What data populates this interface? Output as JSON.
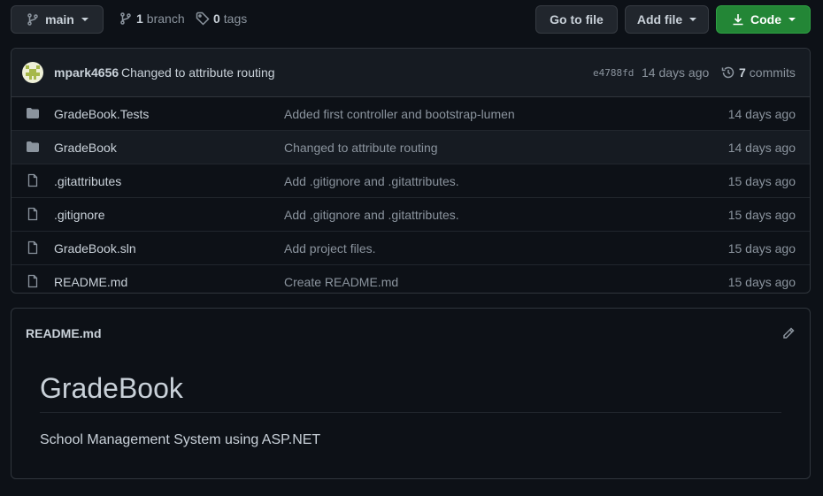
{
  "toolbar": {
    "branch_button": "main",
    "branch_count": "1",
    "branch_label": "branch",
    "tag_count": "0",
    "tag_label": "tags",
    "go_to_file": "Go to file",
    "add_file": "Add file",
    "code": "Code"
  },
  "commit": {
    "author": "mpark4656",
    "message": "Changed to attribute routing",
    "hash": "e4788fd",
    "age": "14 days ago",
    "count": "7",
    "count_label": "commits"
  },
  "files": [
    {
      "type": "folder",
      "name": "GradeBook.Tests",
      "message": "Added first controller and bootstrap-lumen",
      "age": "14 days ago"
    },
    {
      "type": "folder",
      "name": "GradeBook",
      "message": "Changed to attribute routing",
      "age": "14 days ago"
    },
    {
      "type": "file",
      "name": ".gitattributes",
      "message": "Add .gitignore and .gitattributes.",
      "age": "15 days ago"
    },
    {
      "type": "file",
      "name": ".gitignore",
      "message": "Add .gitignore and .gitattributes.",
      "age": "15 days ago"
    },
    {
      "type": "file",
      "name": "GradeBook.sln",
      "message": "Add project files.",
      "age": "15 days ago"
    },
    {
      "type": "file",
      "name": "README.md",
      "message": "Create README.md",
      "age": "15 days ago"
    }
  ],
  "readme": {
    "filename": "README.md",
    "title": "GradeBook",
    "description": "School Management System using ASP.NET"
  },
  "colors": {
    "background": "#0d1117",
    "code_button": "#238636",
    "link": "#58a6ff"
  }
}
